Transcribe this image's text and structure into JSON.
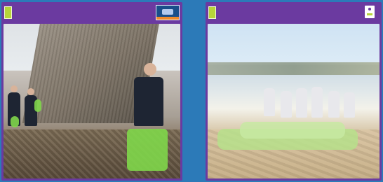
{
  "left_panel": {
    "title": "",
    "badge_icon": "certificate-badge-icon",
    "photo_alt": ""
  },
  "right_panel": {
    "title": "",
    "logo_icon": "organization-logo-icon",
    "photo_alt": ""
  },
  "colors": {
    "page_bg": "#2c7ab8",
    "panel_bg": "#6b3aa0",
    "tag": "#b7d43a",
    "bag": "#7fd74a"
  }
}
